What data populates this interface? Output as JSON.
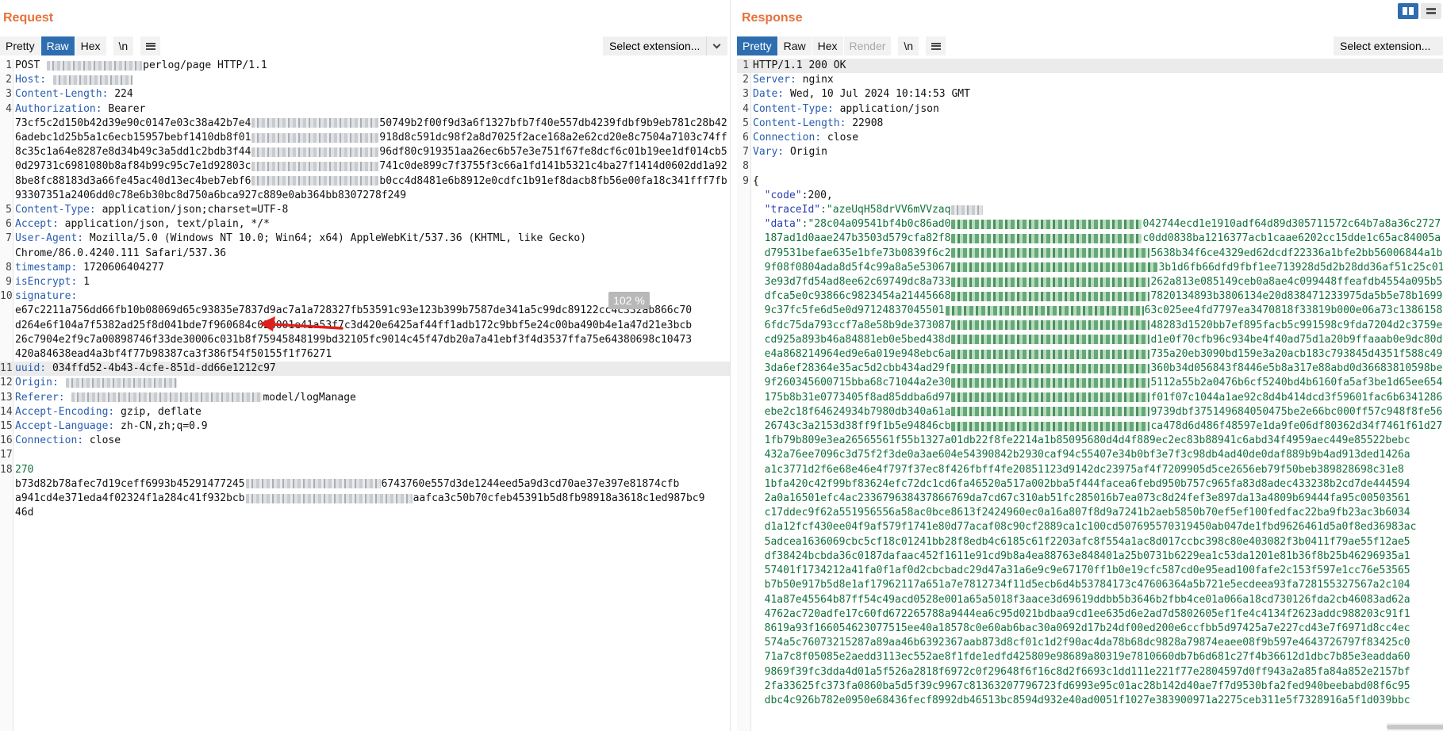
{
  "request": {
    "title": "Request",
    "tabs": [
      "Pretty",
      "Raw",
      "Hex"
    ],
    "active_tab": "Raw",
    "newline_label": "\\n",
    "extension_label": "Select extension...",
    "zoom": "102 %",
    "lines": [
      {
        "n": "1",
        "segments": [
          {
            "t": "POST ",
            "c": "val"
          },
          {
            "blur": 120
          },
          {
            "t": "perlog/page HTTP/1.1",
            "c": "val"
          }
        ]
      },
      {
        "n": "2",
        "segments": [
          {
            "t": "Host:",
            "c": "hkey"
          },
          {
            "t": " ",
            "c": "val"
          },
          {
            "blur": 100
          }
        ]
      },
      {
        "n": "3",
        "segments": [
          {
            "t": "Content-Length:",
            "c": "hkey"
          },
          {
            "t": " 224",
            "c": "val"
          }
        ]
      },
      {
        "n": "4",
        "segments": [
          {
            "t": "Authorization:",
            "c": "hkey"
          },
          {
            "t": " Bearer",
            "c": "val"
          }
        ],
        "cont": [
          [
            {
              "t": "73cf5c2d150b42d39e90c0147e03c38a42b7e4",
              "c": "val"
            },
            {
              "blur": 160
            },
            {
              "t": "50749b2f00f9d3a6f1327bfb7f40e557db4239fdbf9b9eb781c28b42",
              "c": "val"
            }
          ],
          [
            {
              "t": "6adebc1d25b5a1c6ecb15957bebf1410db8f01",
              "c": "val"
            },
            {
              "blur": 160
            },
            {
              "t": "918d8c591dc98f2a8d7025f2ace168a2e62cd20e8c7504a7103c74ff",
              "c": "val"
            }
          ],
          [
            {
              "t": "8c35c1a64e8287e8d34b49c3a5dd1c2bdb3f44",
              "c": "val"
            },
            {
              "blur": 160
            },
            {
              "t": "96df80c919351aa26ec6b57e3e751f67fe8dcf6c01b19ee1df014cb5",
              "c": "val"
            }
          ],
          [
            {
              "t": "0d29731c6981080b8af84b99c95c7e1d92803c",
              "c": "val"
            },
            {
              "blur": 160
            },
            {
              "t": "741c0de899c7f3755f3c66a1fd141b5321c4ba27f1414d0602dd1a92",
              "c": "val"
            }
          ],
          [
            {
              "t": "8be8fc88183d3a66fe45ac40d13ec4beb7ebf6",
              "c": "val"
            },
            {
              "blur": 160
            },
            {
              "t": "b0cc4d8481e6b8912e0cdfc1b91ef8dacb8fb56e00fa18c341fff7fb",
              "c": "val"
            }
          ],
          [
            {
              "t": "93307351a2406dd0c78e6b30bc8d750a6bca927c889e0ab364bb8307278f249",
              "c": "val"
            }
          ]
        ]
      },
      {
        "n": "5",
        "segments": [
          {
            "t": "Content-Type:",
            "c": "hkey"
          },
          {
            "t": " application/json;charset=UTF-8",
            "c": "val"
          }
        ]
      },
      {
        "n": "6",
        "segments": [
          {
            "t": "Accept:",
            "c": "hkey"
          },
          {
            "t": " application/json, text/plain, */*",
            "c": "val"
          }
        ]
      },
      {
        "n": "7",
        "segments": [
          {
            "t": "User-Agent:",
            "c": "hkey"
          },
          {
            "t": " Mozilla/5.0 (Windows NT 10.0; Win64; x64) AppleWebKit/537.36 (KHTML, like Gecko)",
            "c": "val"
          }
        ],
        "cont": [
          [
            {
              "t": "Chrome/86.0.4240.111 Safari/537.36",
              "c": "val"
            }
          ]
        ]
      },
      {
        "n": "8",
        "segments": [
          {
            "t": "timestamp:",
            "c": "hkey"
          },
          {
            "t": " 1720606404277",
            "c": "val"
          }
        ]
      },
      {
        "n": "9",
        "segments": [
          {
            "t": "isEncrypt:",
            "c": "hkey"
          },
          {
            "t": " 1",
            "c": "val"
          }
        ]
      },
      {
        "n": "10",
        "segments": [
          {
            "t": "signature:",
            "c": "hkey"
          }
        ],
        "cont": [
          [
            {
              "t": "e67c2211a756dd66fb10b08069d65c93835e7837d9ac7a1a728327fb53591c93e123b399b7587de341a5c99dc89122cc4c332ab866c70",
              "c": "val"
            }
          ],
          [
            {
              "t": "d264e6f104a7f5382ad25f8d041bde7f960684c028001e41a53f7c3d420e6425af44ff1adb172c9bbf5e24c00ba490b4e1a47d21e3bcb",
              "c": "val"
            }
          ],
          [
            {
              "t": "26c7904e2f9c7a00898746f33de30006c031b8f75945848199bd32105fc9014c45f47db20a7a41ebf3f4d3537ffa75e64380698c10473",
              "c": "val"
            }
          ],
          [
            {
              "t": "420a84638ead4a3bf4f77b98387ca3f386f54f50155f1f76271",
              "c": "val"
            }
          ]
        ]
      },
      {
        "n": "11",
        "highlight": true,
        "segments": [
          {
            "t": "uuid:",
            "c": "hkey"
          },
          {
            "t": " 034ffd52-4b43-4cfe-851d-dd66e1212c97",
            "c": "val"
          }
        ]
      },
      {
        "n": "12",
        "segments": [
          {
            "t": "Origin:",
            "c": "hkey"
          },
          {
            "t": " ",
            "c": "val"
          },
          {
            "blur": 140
          }
        ]
      },
      {
        "n": "13",
        "segments": [
          {
            "t": "Referer:",
            "c": "hkey"
          },
          {
            "t": " ",
            "c": "val"
          },
          {
            "blur": 240
          },
          {
            "t": "model/logManage",
            "c": "val"
          }
        ]
      },
      {
        "n": "14",
        "segments": [
          {
            "t": "Accept-Encoding:",
            "c": "hkey"
          },
          {
            "t": " gzip, deflate",
            "c": "val"
          }
        ]
      },
      {
        "n": "15",
        "segments": [
          {
            "t": "Accept-Language:",
            "c": "hkey"
          },
          {
            "t": " zh-CN,zh;q=0.9",
            "c": "val"
          }
        ]
      },
      {
        "n": "16",
        "segments": [
          {
            "t": "Connection:",
            "c": "hkey"
          },
          {
            "t": " close",
            "c": "val"
          }
        ]
      },
      {
        "n": "17",
        "segments": []
      },
      {
        "n": "18",
        "segments": [
          {
            "t": "270",
            "c": "body-str"
          }
        ],
        "cont": [
          [
            {
              "t": "b73d82b78afec7d19ceff6993b45291477245",
              "c": "val"
            },
            {
              "blur": 170
            },
            {
              "t": "6743760e557d3de1244eed5a9d3cd70ae37e397e81874cfb",
              "c": "val"
            }
          ],
          [
            {
              "t": "a941cd4e371eda4f02324f1a284c41f932bcb",
              "c": "val"
            },
            {
              "blur": 210
            },
            {
              "t": "aafca3c50b70cfeb45391b5d8fb98918a3618c1ed987bc9",
              "c": "val"
            }
          ],
          [
            {
              "t": "46d",
              "c": "val"
            }
          ]
        ]
      }
    ]
  },
  "response": {
    "title": "Response",
    "tabs": [
      "Pretty",
      "Raw",
      "Hex",
      "Render"
    ],
    "active_tab": "Pretty",
    "newline_label": "\\n",
    "extension_label": "Select extension...",
    "lines": [
      {
        "n": "1",
        "segments": [
          {
            "t": "HTTP/1.1 200 OK",
            "c": "val"
          }
        ],
        "highlight": true
      },
      {
        "n": "2",
        "segments": [
          {
            "t": "Server:",
            "c": "hkey"
          },
          {
            "t": " nginx",
            "c": "val"
          }
        ]
      },
      {
        "n": "3",
        "segments": [
          {
            "t": "Date:",
            "c": "hkey"
          },
          {
            "t": " Wed, 10 Jul 2024 10:14:53 GMT",
            "c": "val"
          }
        ]
      },
      {
        "n": "4",
        "segments": [
          {
            "t": "Content-Type:",
            "c": "hkey"
          },
          {
            "t": " application/json",
            "c": "val"
          }
        ]
      },
      {
        "n": "5",
        "segments": [
          {
            "t": "Content-Length:",
            "c": "hkey"
          },
          {
            "t": " 22908",
            "c": "val"
          }
        ]
      },
      {
        "n": "6",
        "segments": [
          {
            "t": "Connection:",
            "c": "hkey"
          },
          {
            "t": " close",
            "c": "val"
          }
        ]
      },
      {
        "n": "7",
        "segments": [
          {
            "t": "Vary:",
            "c": "hkey"
          },
          {
            "t": " Origin",
            "c": "val"
          }
        ]
      },
      {
        "n": "8",
        "segments": []
      },
      {
        "n": "9",
        "segments": [
          {
            "t": "{",
            "c": "val"
          }
        ],
        "cont": [
          [
            {
              "t": "  \"code\"",
              "c": "json-key"
            },
            {
              "t": ":200,",
              "c": "val"
            }
          ],
          [
            {
              "t": "  \"traceId\"",
              "c": "json-key"
            },
            {
              "t": ":\"azeUqH58drVV6mVVzaq",
              "c": "body-str"
            },
            {
              "blur": 40
            }
          ],
          [
            {
              "t": "  \"data\"",
              "c": "json-key"
            },
            {
              "t": ":\"28c04a09541bf4b0c86ad0",
              "c": "body-str"
            },
            {
              "blur": 240,
              "g": 1
            },
            {
              "t": "042744ecd1e1910adf64d89d305711572c64b7a8a36c2727",
              "c": "body-str"
            }
          ],
          [
            {
              "t": "  187ad1d0aae247b3503d579cfa82f8",
              "c": "body-str"
            },
            {
              "blur": 240,
              "g": 1
            },
            {
              "t": "c0dd0838ba1216377acb1caae6202cc15dde1c65ac84005a",
              "c": "body-str"
            }
          ],
          [
            {
              "t": "  d79531befae635e1bfe73b0839f6c2",
              "c": "body-str"
            },
            {
              "blur": 250,
              "g": 1
            },
            {
              "t": "5638b34f6ce4329ed62dcdf22336a1bfe2bb56006844a1bc",
              "c": "body-str"
            }
          ],
          [
            {
              "t": "  9f08f0804ada8d5f4c99a8a5e53067",
              "c": "body-str"
            },
            {
              "blur": 260,
              "g": 1
            },
            {
              "t": "3b1d6fb66dfd9fbf1ee713928d5d2b28dd36af51c25c01dc",
              "c": "body-str"
            }
          ],
          [
            {
              "t": "  3e93d7fd54ad8ee62c69749dc8a733",
              "c": "body-str"
            },
            {
              "blur": 250,
              "g": 1
            },
            {
              "t": "262a813e085149ceb0a8ae4c099448ffeafdb4554a095b5",
              "c": "body-str"
            }
          ],
          [
            {
              "t": "  dfca5e0c93866c9823454a21445668",
              "c": "body-str"
            },
            {
              "blur": 250,
              "g": 1
            },
            {
              "t": "7820134893b3806134e20d838471233975da5b5e78b16998",
              "c": "body-str"
            }
          ],
          [
            {
              "t": "  9c37fc5fe6d5e0d97124837045501",
              "c": "body-str"
            },
            {
              "blur": 250,
              "g": 1
            },
            {
              "t": "63c025ee4fd7797ea3470818f33819b000e06a73c1386158",
              "c": "body-str"
            }
          ],
          [
            {
              "t": "  6fdc75da793ccf7a8e58b9de373087",
              "c": "body-str"
            },
            {
              "blur": 250,
              "g": 1
            },
            {
              "t": "48283d1520bb7ef895facb5c991598c9fda7204d2c3759e",
              "c": "body-str"
            }
          ],
          [
            {
              "t": "  cd925a893b46a84881eb0e5bed438d",
              "c": "body-str"
            },
            {
              "blur": 250,
              "g": 1
            },
            {
              "t": "d1e0f70cfb96c934be4f40ad75d1a20b9ffaaab0e9dc80d6",
              "c": "body-str"
            }
          ],
          [
            {
              "t": "  e4a868214964ed9e6a019e948ebc6a",
              "c": "body-str"
            },
            {
              "blur": 250,
              "g": 1
            },
            {
              "t": "735a20eb3090bd159e3a20acb183c793845d4351f588c49f",
              "c": "body-str"
            }
          ],
          [
            {
              "t": "  3da6ef28364e35ac5d2cbb434ad29f",
              "c": "body-str"
            },
            {
              "blur": 250,
              "g": 1
            },
            {
              "t": "360b34d056843f8446e5b8a317e88abd0d36683810598be5",
              "c": "body-str"
            }
          ],
          [
            {
              "t": "  9f260345600715bba68c71044a2e30",
              "c": "body-str"
            },
            {
              "blur": 250,
              "g": 1
            },
            {
              "t": "5112a55b2a0476b6cf5240bd4b6160fa5af3be1d65ee6544",
              "c": "body-str"
            }
          ],
          [
            {
              "t": "  175b8b31e0773405f8ad85ddba6d97",
              "c": "body-str"
            },
            {
              "blur": 250,
              "g": 1
            },
            {
              "t": "f01f07c1044a1ae92c8d4b414dcd3f59601fac6b6341286a",
              "c": "body-str"
            }
          ],
          [
            {
              "t": "  ebe2c18f64624934b7980db340a61a",
              "c": "body-str"
            },
            {
              "blur": 250,
              "g": 1
            },
            {
              "t": "9739dbf375149684050475be2e66bc000ff57c948f8fe561",
              "c": "body-str"
            }
          ],
          [
            {
              "t": "  26743c3a2153d38ff9f1b5e94846cb",
              "c": "body-str"
            },
            {
              "blur": 250,
              "g": 1
            },
            {
              "t": "ca478d6d486f48597e1da9fe06df80362d34f7461f61d27f",
              "c": "body-str"
            }
          ],
          [
            {
              "t": "  1fb79b809e3ea26565561f55b1327a01db22f8fe2214a1b85095680d4d4f889ec2ec83b88941c6abd34f4959aec449e85522bebc",
              "c": "body-str"
            }
          ],
          [
            {
              "t": "  432a76ee7096c3d75f2f3de0a3ae604e54390842b2930caf94c55407e34b0bf3e7f3c98db4ad40de0daf889b9b4ad913ded1426a",
              "c": "body-str"
            }
          ],
          [
            {
              "t": "  a1c3771d2f6e68e46e4f797f37ec8f426fbff4fe20851123d9142dc23975af4f7209905d5ce2656eb79f50beb389828698c31e8",
              "c": "body-str"
            }
          ],
          [
            {
              "t": "  1bfa420c42f99bf83624efc72dc1cd6fa46520a517a002bba5f444facea6febd950b757c965fa83d8adec433238b2cd7de444594",
              "c": "body-str"
            }
          ],
          [
            {
              "t": "  2a0a16501efc4ac233679638437866769da7cd67c310ab51fc285016b7ea073c8d24fef3e897da13a4809b69444fa95c00503561",
              "c": "body-str"
            }
          ],
          [
            {
              "t": "  c17ddec9f62a551956556a58ac0bce8613f2424960ec0a16a807f8d9a7241b2aeb5850b70ef5ef100fedfac22ba9fb23ac3b6034",
              "c": "body-str"
            }
          ],
          [
            {
              "t": "  d1a12fcf430ee04f9af579f1741e80d77acaf08c90cf2889ca1c100cd507695570319450ab047de1fbd9626461d5a0f8ed36983ac",
              "c": "body-str"
            }
          ],
          [
            {
              "t": "  5adcea1636069cbc5cf18c01241bb28f8edb4c6185c61f2203afc8f554a1ac8d017ccbc398c80e403082f3b0411f79ae55f12ae5",
              "c": "body-str"
            }
          ],
          [
            {
              "t": "  df38424bcbda36c0187dafaac452f1611e91cd9b8a4ea88763e848401a25b0731b6229ea1c53da1201e81b36f8b25b46296935a1",
              "c": "body-str"
            }
          ],
          [
            {
              "t": "  57401f1734212a41fa0f1af0d2cbcbadc29d47a31a6e9c9e67170ff1b0e19cfc587cd0e95ead100fafe2c153f597e1cc76e53565",
              "c": "body-str"
            }
          ],
          [
            {
              "t": "  b7b50e917b5d8e1af17962117a651a7e7812734f11d5ecb6d4b53784173c47606364a5b721e5ecdeea93fa728155327567a2c104",
              "c": "body-str"
            }
          ],
          [
            {
              "t": "  41a87e45564b87ff54c49acd0528e001a65a5018f3aace3d69619ddbb5b3646b2fbb4ce01a066a18cd730126fda2cb46083ad62a",
              "c": "body-str"
            }
          ],
          [
            {
              "t": "  4762ac720adfe17c60fd672265788a9444ea6c95d021bdbaa9cd1ee635d6e2ad7d5802605ef1fe4c4134f2623addc988203c91f1",
              "c": "body-str"
            }
          ],
          [
            {
              "t": "  8619a93f166054623077515ee40a18578c0e60ab6bac30a0692d17b24df00ed200e6ccfbb5d97425a7e227cd43e7f6971d8cc4ec",
              "c": "body-str"
            }
          ],
          [
            {
              "t": "  574a5c76073215287a89aa46b6392367aab873d8cf01c1d2f90ac4da78b68dc9828a79874eaee08f9b597e4643726797f83425c0",
              "c": "body-str"
            }
          ],
          [
            {
              "t": "  71a7c8f05085e2aedd3113ec552ae8f1fde1edfd425809e98689a80319e7810660db7b6d681c27f4b36612d1dbc7b85e3eadda60",
              "c": "body-str"
            }
          ],
          [
            {
              "t": "  9869f39fc3dda4d01a5f526a2818f6972c0f29648f6f16c8d2f6693c1dd111e221f77e2804597d0ff943a2a85fa84a852e2157bf",
              "c": "body-str"
            }
          ],
          [
            {
              "t": "  2fa33625fc373fa0860ba5d5f39c9967c81363207796723fd6993e95c01ac28b142d40ae7f7d9530bfa2fed940beebabd08f6c95",
              "c": "body-str"
            }
          ],
          [
            {
              "t": "  dbc4c926b782e0950e68436fecf8992db46513bc8594d932e40ad0051f1027e383900971a2275ceb311e5f7328916a5f1d039bbc",
              "c": "body-str"
            }
          ]
        ]
      }
    ]
  }
}
